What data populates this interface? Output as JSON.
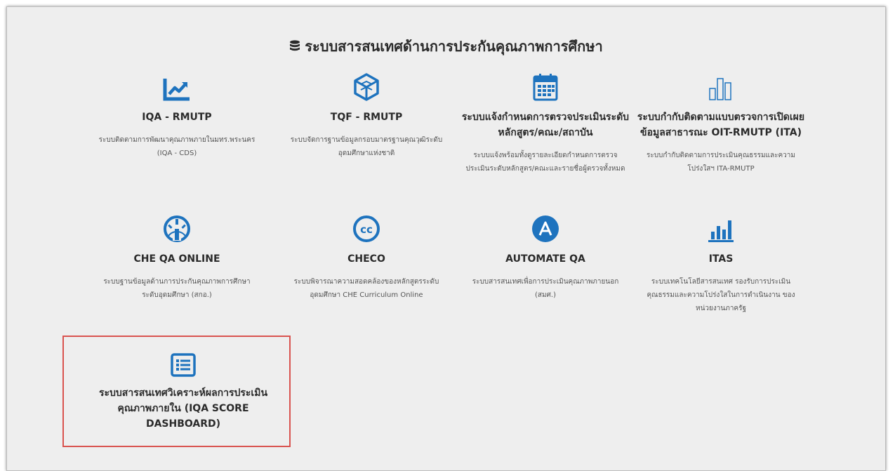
{
  "heading": "ระบบสารสนเทศด้านการประกันคุณภาพการศึกษา",
  "colors": {
    "accent": "#1e73be",
    "frame_bg": "#eeeeee",
    "highlight_border": "#d9534f"
  },
  "cards": [
    {
      "icon": "line-chart-icon",
      "title": "IQA - RMUTP",
      "desc": "ระบบติดตามการพัฒนาคุณภาพภายในมทร.พระนคร (IQA - CDS)"
    },
    {
      "icon": "cube-icon",
      "title": "TQF - RMUTP",
      "desc": "ระบบจัดการฐานข้อมูลกรอบมาตรฐานคุณวุฒิระดับอุดมศึกษาแห่งชาติ"
    },
    {
      "icon": "calendar-icon",
      "title": "ระบบแจ้งกำหนดการตรวจประเมินระดับหลักสูตร/คณะ/สถาบัน",
      "desc": "ระบบแจ้งพร้อมทั้งดูรายละเอียดกำหนดการตรวจประเมินระดับหลักสูตร/คณะและรายชื่อผู้ตรวจทั้งหมด"
    },
    {
      "icon": "bar-chart-outline-icon",
      "title": "ระบบกำกับติดตามแบบตรวจการเปิดเผยข้อมูลสาธารณะ OIT-RMUTP (ITA)",
      "desc": "ระบบกำกับติดตามการประเมินคุณธรรมและความโปร่งใสฯ ITA-RMUTP"
    },
    {
      "icon": "dashboard-gauge-icon",
      "title": "CHE QA ONLINE",
      "desc": "ระบบฐานข้อมูลด้านการประกันคุณภาพการศึกษาระดับอุดมศึกษา (สกอ.)"
    },
    {
      "icon": "creative-commons-icon",
      "title": "CHECO",
      "desc": "ระบบพิจารณาความสอดคล้องของหลักสูตรระดับอุดมศึกษา CHE Curriculum Online"
    },
    {
      "icon": "letter-a-circle-icon",
      "title": "AUTOMATE QA",
      "desc": "ระบบสารสนเทศเพื่อการประเมินคุณภาพภายนอก (สมศ.)"
    },
    {
      "icon": "bar-chart-icon",
      "title": "ITAS",
      "desc": "ระบบเทคโนโลยีสารสนเทศ รองรับการประเมินคุณธรรมและความโปร่งใสในการดำเนินงาน ของหน่วยงานภาครัฐ"
    },
    {
      "icon": "list-alt-icon",
      "title": "ระบบสารสนเทศวิเคราะห์ผลการประเมินคุณภาพภายใน (IQA SCORE DASHBOARD)",
      "desc": ""
    }
  ]
}
